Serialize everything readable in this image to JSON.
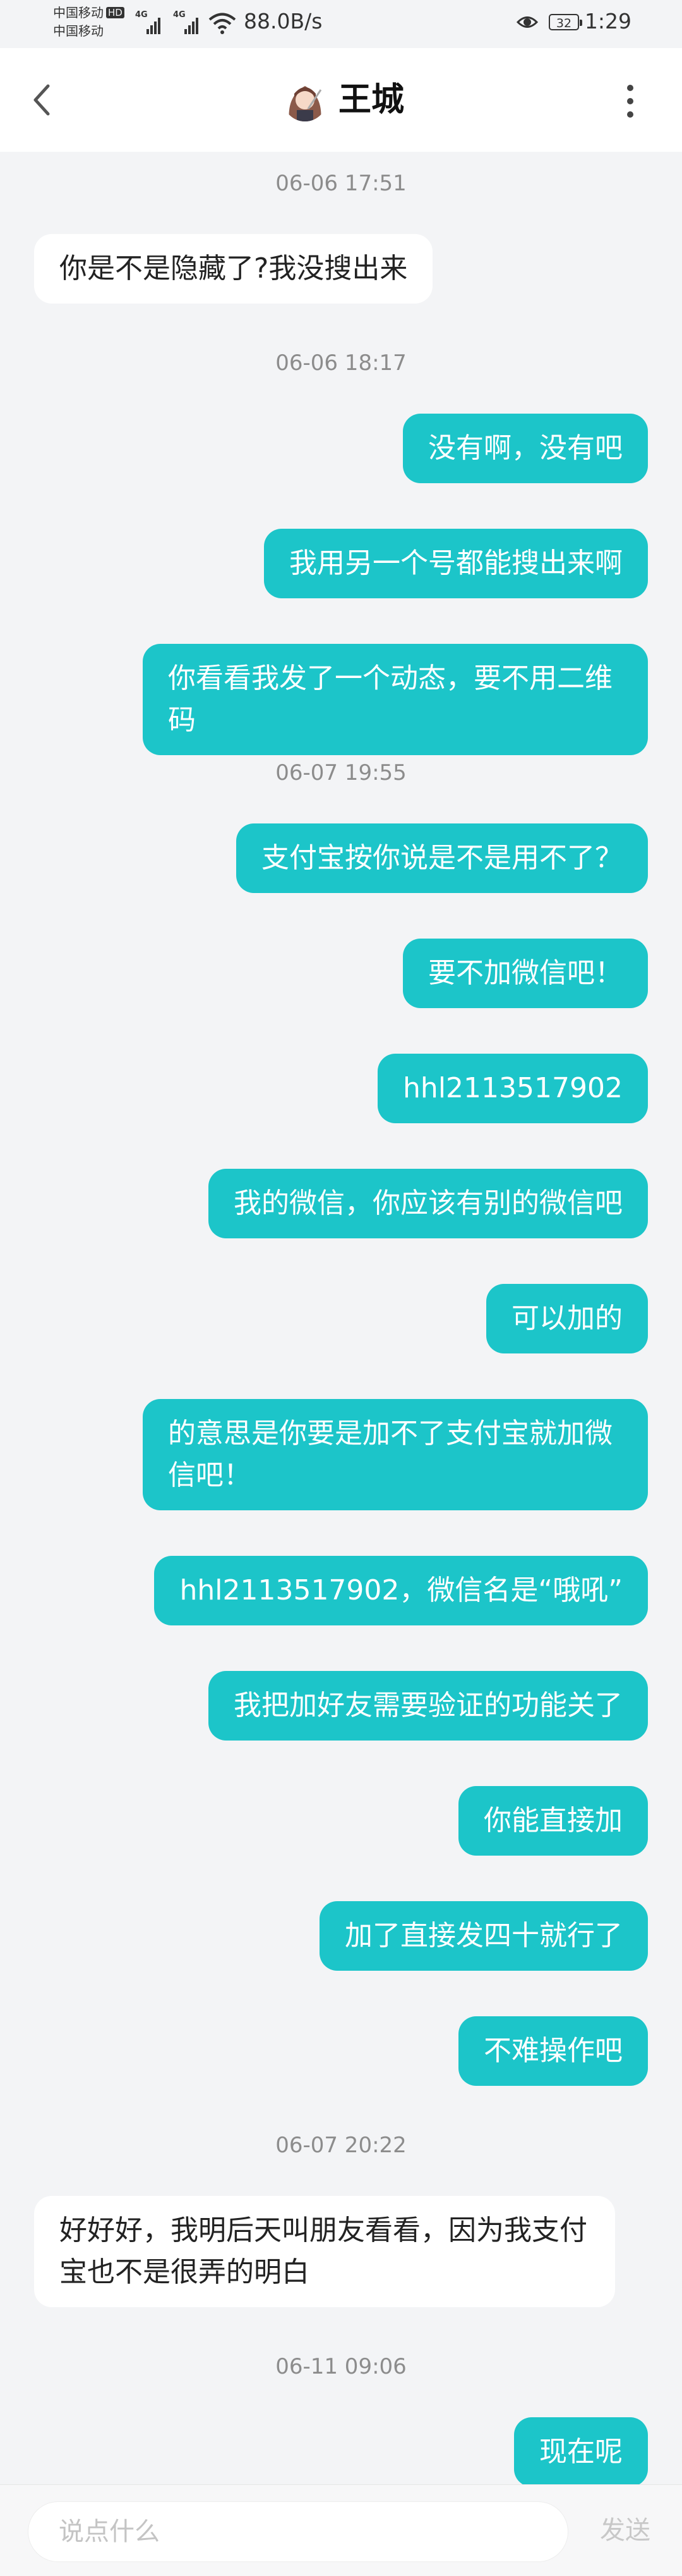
{
  "status_bar": {
    "carrier_1": "中国移动",
    "carrier_hd": "HD",
    "carrier_2": "中国移动",
    "net_type": "4G",
    "net_speed": "88.0B/s",
    "battery": "32",
    "time": "1:29"
  },
  "header": {
    "title": "王城"
  },
  "messages": [
    {
      "type": "timestamp",
      "text": "06-06 17:51"
    },
    {
      "type": "other",
      "text": "你是不是隐藏了?我没搜出来"
    },
    {
      "type": "timestamp",
      "text": "06-06 18:17"
    },
    {
      "type": "me",
      "text": "没有啊，没有吧"
    },
    {
      "type": "me",
      "text": "我用另一个号都能搜出来啊"
    },
    {
      "type": "me",
      "text": "你看看我发了一个动态，要不用二维码"
    },
    {
      "type": "timestamp",
      "text": "06-07 19:55"
    },
    {
      "type": "me",
      "text": "支付宝按你说是不是用不了？"
    },
    {
      "type": "me",
      "text": "要不加微信吧！"
    },
    {
      "type": "me",
      "text": "hhl2113517902"
    },
    {
      "type": "me",
      "text": "我的微信，你应该有别的微信吧"
    },
    {
      "type": "me",
      "text": "可以加的"
    },
    {
      "type": "me",
      "text": "的意思是你要是加不了支付宝就加微信吧！"
    },
    {
      "type": "me",
      "text": "hhl2113517902，微信名是“哦吼”"
    },
    {
      "type": "me",
      "text": "我把加好友需要验证的功能关了"
    },
    {
      "type": "me",
      "text": "你能直接加"
    },
    {
      "type": "me",
      "text": "加了直接发四十就行了"
    },
    {
      "type": "me",
      "text": "不难操作吧"
    },
    {
      "type": "timestamp",
      "text": "06-07 20:22"
    },
    {
      "type": "other",
      "text": "好好好，我明后天叫朋友看看，因为我支付宝也不是很弄的明白"
    },
    {
      "type": "timestamp",
      "text": "06-11 09:06"
    },
    {
      "type": "me",
      "text": "现在呢"
    }
  ],
  "input": {
    "placeholder": "说点什么",
    "send_label": "发送"
  },
  "colors": {
    "my_bubble": "#1cc5c9",
    "other_bubble": "#ffffff",
    "background": "#f3f4f6"
  }
}
